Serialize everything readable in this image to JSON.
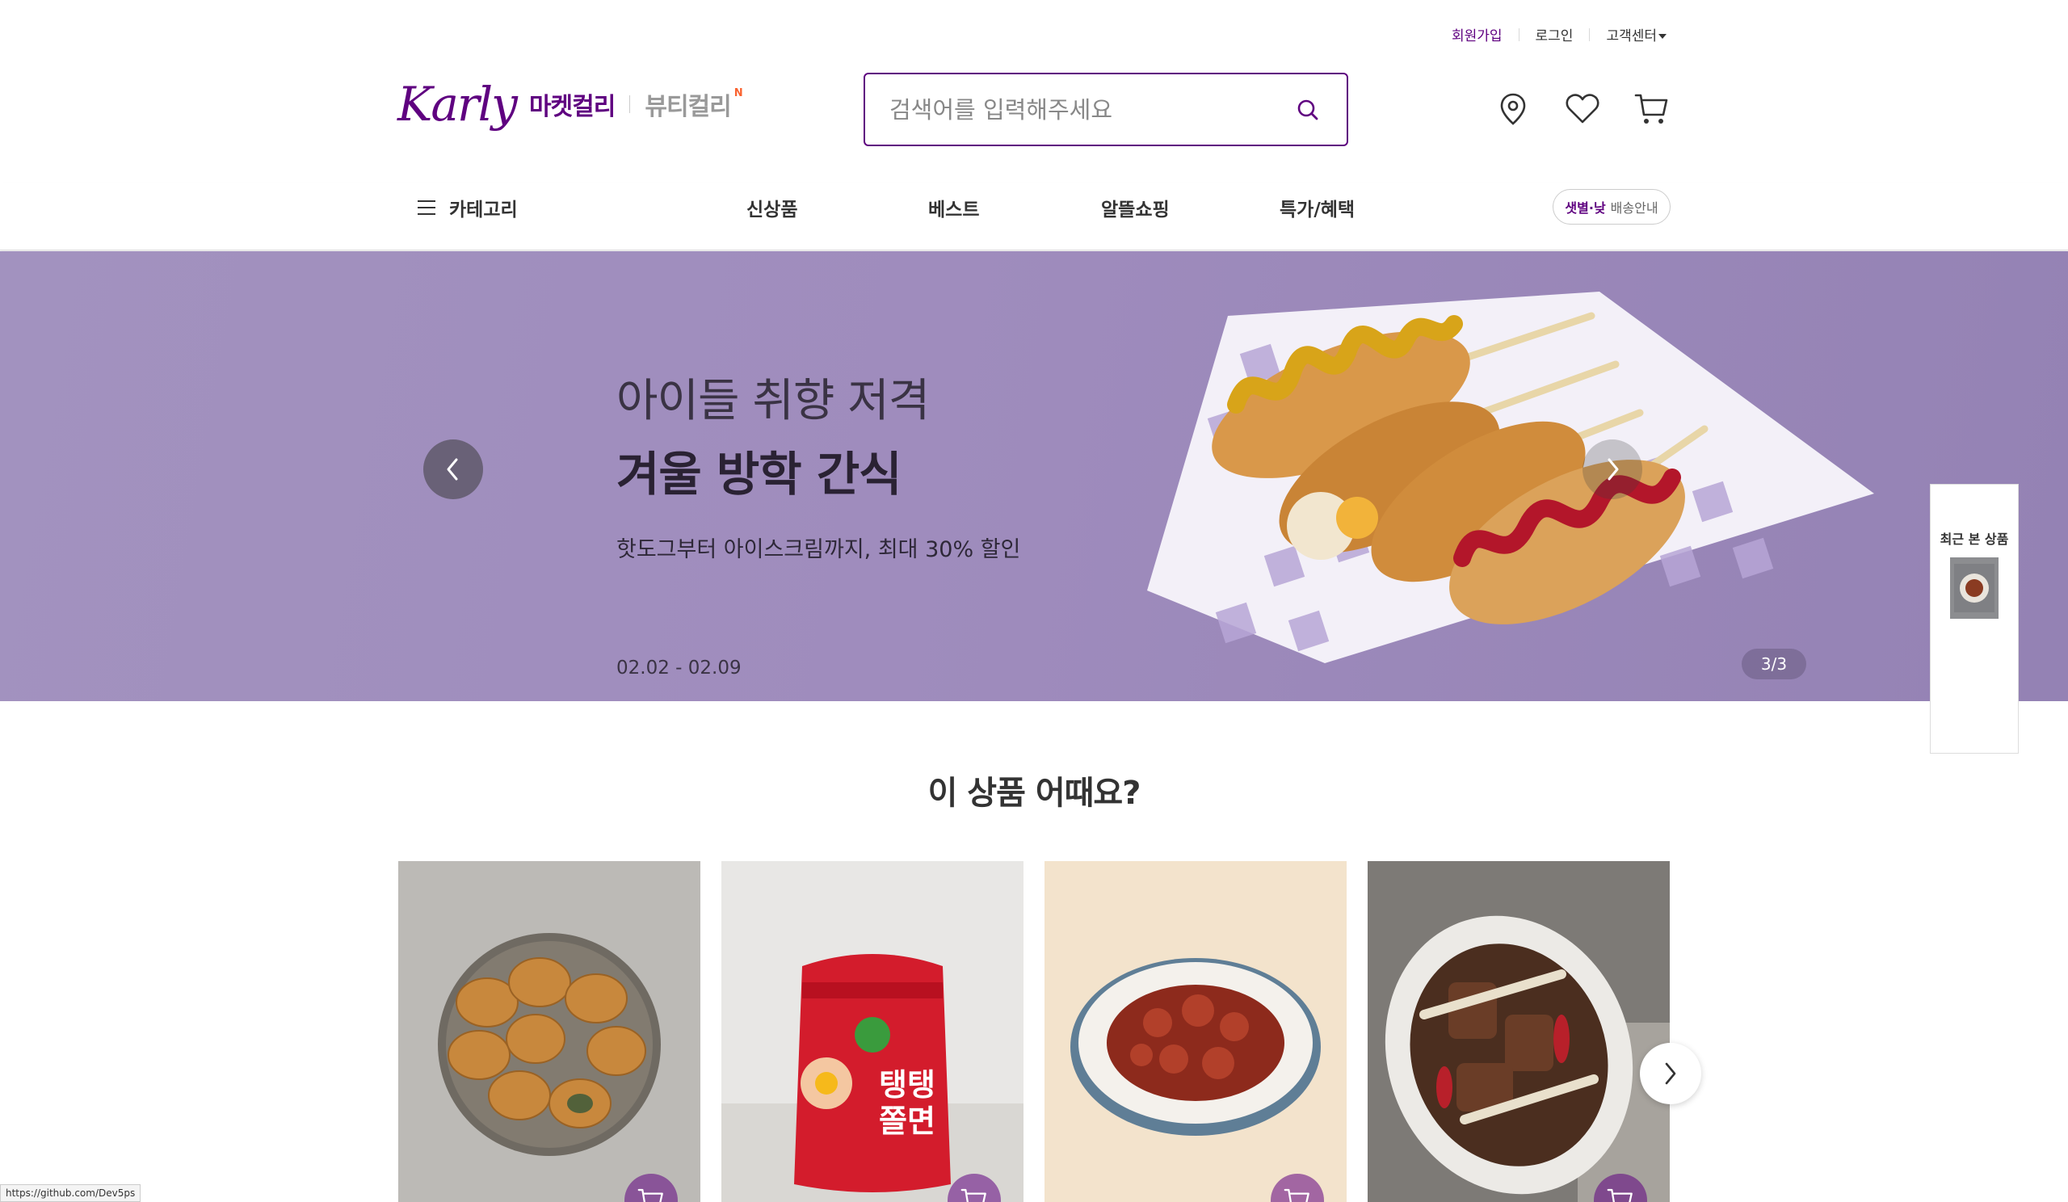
{
  "header": {
    "util_links": {
      "join": "회원가입",
      "login": "로그인",
      "customer_center": "고객센터"
    },
    "logo_text": "Karly",
    "market_label": "마켓컬리",
    "beauty_label": "뷰티컬리",
    "beauty_badge": "N",
    "search": {
      "placeholder": "검색어를 입력해주세요",
      "value": ""
    },
    "icons": [
      "location-icon",
      "heart-icon",
      "cart-icon"
    ]
  },
  "gnb": {
    "category_label": "카테고리",
    "menu": [
      {
        "label": "신상품"
      },
      {
        "label": "베스트"
      },
      {
        "label": "알뜰쇼핑"
      },
      {
        "label": "특가/혜택"
      }
    ],
    "delivery": {
      "highlight": "샛별·낮",
      "label": "배송안내"
    }
  },
  "banner": {
    "subtitle": "아이들 취향 저격",
    "title": "겨울 방학 간식",
    "description": "핫도그부터 아이스크림까지, 최대 30% 할인",
    "date_range": "02.02 - 02.09",
    "counter": "3/3"
  },
  "recent": {
    "title": "최근 본 상품"
  },
  "section": {
    "title": "이 상품 어때요?"
  },
  "products": [
    {
      "image": "fried-dumplings-plate"
    },
    {
      "image": "tangtang-jjolmyeon-package",
      "package_text": "탱탱 쫄면"
    },
    {
      "image": "spicy-octopus-plate"
    },
    {
      "image": "braised-short-ribs-plate"
    }
  ],
  "status_url": "https://github.com/Dev5ps",
  "colors": {
    "brand": "#5f0080",
    "banner_bg": "#a292bf"
  }
}
